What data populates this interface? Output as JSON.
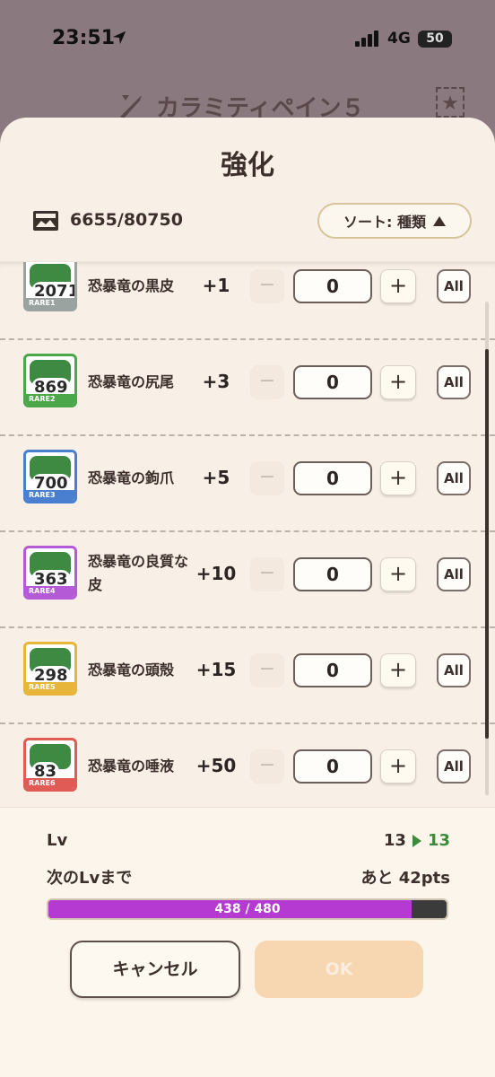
{
  "status_bar": {
    "time": "23:51",
    "network": "4G",
    "battery": "50"
  },
  "background": {
    "title": "カラミティペイン５"
  },
  "sheet": {
    "title": "強化",
    "materials": "6655/80750",
    "sort_label": "ソート:  種類"
  },
  "items": [
    {
      "name": "恐暴竜の黒皮",
      "count": "2071",
      "rarity": "RARE1",
      "rarity_color": "#9aa3a0",
      "bonus": "+1",
      "quantity": "0",
      "minus": "−",
      "plus": "+",
      "all": "All"
    },
    {
      "name": "恐暴竜の尻尾",
      "count": "869",
      "rarity": "RARE2",
      "rarity_color": "#4ca64a",
      "bonus": "+3",
      "quantity": "0",
      "minus": "−",
      "plus": "+",
      "all": "All"
    },
    {
      "name": "恐暴竜の鉤爪",
      "count": "700",
      "rarity": "RARE3",
      "rarity_color": "#4a7fcf",
      "bonus": "+5",
      "quantity": "0",
      "minus": "−",
      "plus": "+",
      "all": "All"
    },
    {
      "name": "恐暴竜の良質な皮",
      "count": "363",
      "rarity": "RARE4",
      "rarity_color": "#b55ad6",
      "bonus": "+10",
      "quantity": "0",
      "minus": "−",
      "plus": "+",
      "all": "All"
    },
    {
      "name": "恐暴竜の頭殻",
      "count": "298",
      "rarity": "RARE5",
      "rarity_color": "#e6b53a",
      "bonus": "+15",
      "quantity": "0",
      "minus": "−",
      "plus": "+",
      "all": "All"
    },
    {
      "name": "恐暴竜の唾液",
      "count": "83",
      "rarity": "RARE6",
      "rarity_color": "#e05a56",
      "bonus": "+50",
      "quantity": "0",
      "minus": "−",
      "plus": "+",
      "all": "All"
    }
  ],
  "level": {
    "label": "Lv",
    "current": "13",
    "next": "13",
    "next_label": "次のLvまで",
    "remaining": "あと 42pts",
    "progress_text": "438 / 480",
    "progress_fraction": 0.9125
  },
  "buttons": {
    "cancel": "キャンセル",
    "ok": "OK"
  }
}
